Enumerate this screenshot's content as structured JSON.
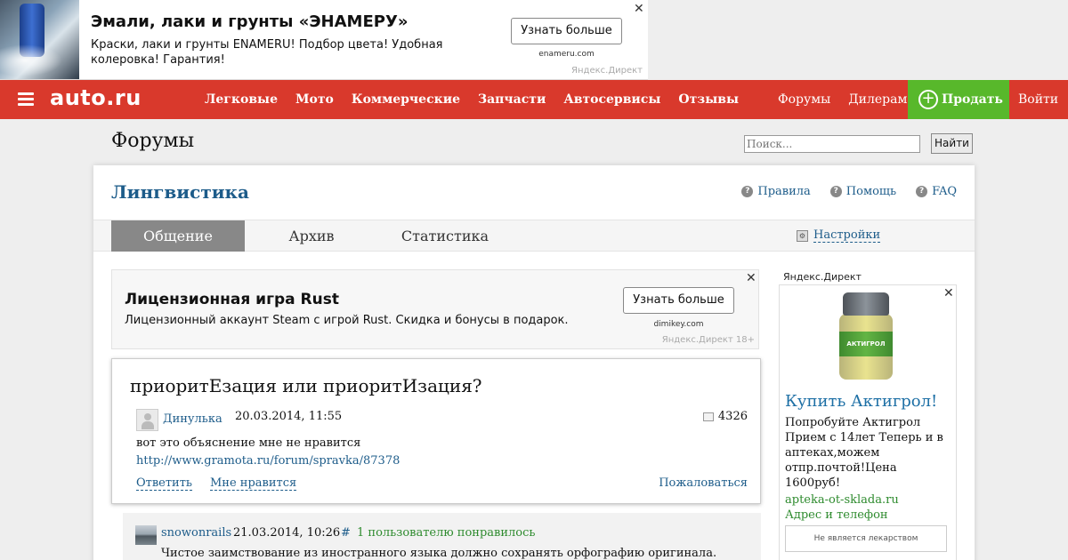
{
  "top_ad": {
    "title": "Эмали, лаки и грунты «ЭНАМЕРУ»",
    "description": "Краски, лаки и грунты ENAMERU! Подбор цвета! Удобная колеровка! Гарантия!",
    "button_label": "Узнать больше",
    "domain": "enameru.com",
    "source": "Яндекс.Директ",
    "close": "✕"
  },
  "nav": {
    "logo": "auto.ru",
    "links": [
      "Легковые",
      "Мото",
      "Коммерческие",
      "Запчасти",
      "Автосервисы",
      "Отзывы"
    ],
    "right_links": [
      "Форумы",
      "Дилерам"
    ],
    "sell_label": "Продать",
    "sell_icon": "+",
    "login_label": "Войти"
  },
  "header": {
    "title": "Форумы",
    "search_placeholder": "Поиск...",
    "search_button": "Найти"
  },
  "forum": {
    "name": "Лингвистика",
    "top_links": [
      {
        "icon": "?",
        "label": "Правила"
      },
      {
        "icon": "?",
        "label": "Помощь"
      },
      {
        "icon": "?",
        "label": "FAQ"
      }
    ],
    "tabs": [
      "Общение",
      "Архив",
      "Статистика"
    ],
    "active_tab": "Общение",
    "settings_label": "Настройки",
    "settings_icon": "⚙"
  },
  "mid_ad": {
    "title": "Лицензионная игра Rust",
    "description": "Лицензионный аккаунт Steam с игрой Rust. Скидка и бонусы в подарок.",
    "button_label": "Узнать больше",
    "domain": "dimikey.com",
    "source": "Яндекс.Директ 18+",
    "close": "✕"
  },
  "topic": {
    "title": "приоритЕзация или приоритИзация?",
    "author": "Динулька",
    "date": "20.03.2014, 11:55",
    "views": "4326",
    "body": "вот это объяснение мне не нравится",
    "link": "http://www.gramota.ru/forum/spravka/87378",
    "reply_label": "Ответить",
    "like_label": "Мне нравится",
    "report_label": "Пожаловаться"
  },
  "reply": {
    "author": "snowonrails",
    "date": "21.03.2014, 10:26",
    "hash": "#",
    "likes": "1 пользователю понравилось",
    "text": "Чистое заимствование из иностранного языка должно сохранять орфографию оригинала."
  },
  "side_ad": {
    "label": "Яндекс.Директ",
    "product_label": "АКТИГРОЛ",
    "title": "Купить Актигрол!",
    "description": "Попробуйте Актигрол Прием с 14лет Теперь и в аптеках,можем отпр.почтой!Цена 1600руб!",
    "domain": "apteka-ot-sklada.ru",
    "contact": "Адрес и телефон",
    "note": "Не является лекарством",
    "close": "✕"
  }
}
